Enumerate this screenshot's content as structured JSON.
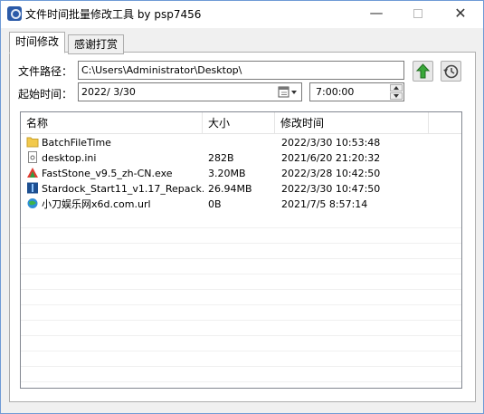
{
  "window": {
    "title": "文件时间批量修改工具 by psp7456",
    "minimize_glyph": "—",
    "close_glyph": "✕"
  },
  "tabs": [
    {
      "label": "时间修改",
      "active": true
    },
    {
      "label": "感谢打赏",
      "active": false
    }
  ],
  "form": {
    "path_label": "文件路径：",
    "path_value": "C:\\Users\\Administrator\\Desktop\\",
    "start_label": "起始时间：",
    "date_value": "2022/  3/30",
    "time_value": "7:00:00"
  },
  "file_list": {
    "columns": [
      "名称",
      "大小",
      "修改时间"
    ],
    "rows": [
      {
        "icon": "folder-icon",
        "name": "BatchFileTime",
        "size": "",
        "time": "2022/3/30 10:53:48"
      },
      {
        "icon": "settings-file-icon",
        "name": "desktop.ini",
        "size": "282B",
        "time": "2021/6/20 21:20:32"
      },
      {
        "icon": "faststone-icon",
        "name": "FastStone_v9.5_zh-CN.exe",
        "size": "3.20MB",
        "time": "2022/3/28 10:42:50"
      },
      {
        "icon": "installer-icon",
        "name": "Stardock_Start11_v1.17_Repack....",
        "size": "26.94MB",
        "time": "2022/3/30 10:47:50"
      },
      {
        "icon": "internet-shortcut-icon",
        "name": "小刀娱乐网x6d.com.url",
        "size": "0B",
        "time": "2021/7/5 8:57:14"
      }
    ]
  },
  "colors": {
    "accent_green": "#3aa83a",
    "folder_yellow": "#f2c94c",
    "window_border": "#6f9bd6"
  }
}
